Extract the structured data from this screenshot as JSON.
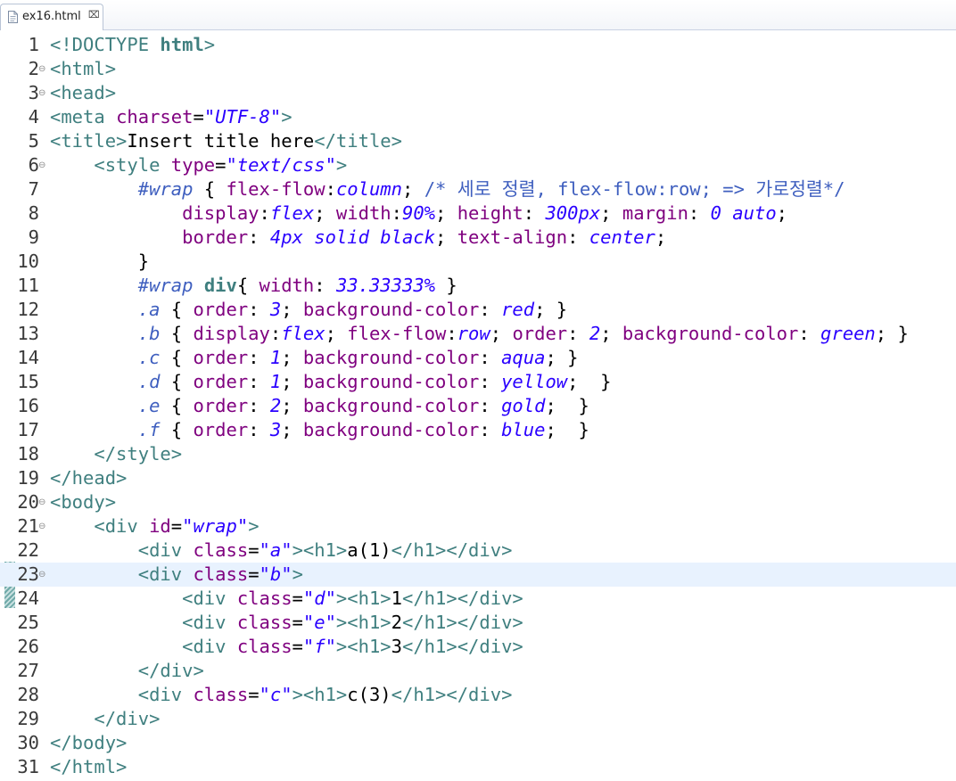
{
  "tab": {
    "title": "ex16.html",
    "close_glyph": "⌧",
    "icon": "html-file-icon"
  },
  "current_line": 23,
  "lines": [
    {
      "n": "1",
      "fold": false,
      "tokens": [
        [
          "k",
          "<!DOCTYPE "
        ],
        [
          "b",
          "html"
        ],
        [
          "k",
          ">"
        ]
      ]
    },
    {
      "n": "2",
      "fold": true,
      "tokens": [
        [
          "k",
          "<html>"
        ]
      ]
    },
    {
      "n": "3",
      "fold": true,
      "tokens": [
        [
          "k",
          "<head>"
        ]
      ]
    },
    {
      "n": "4",
      "fold": false,
      "tokens": [
        [
          "k",
          "<meta "
        ],
        [
          "a",
          "charset"
        ],
        [
          "t",
          "="
        ],
        [
          "s",
          "\"UTF-8\""
        ],
        [
          "k",
          ">"
        ]
      ]
    },
    {
      "n": "5",
      "fold": false,
      "tokens": [
        [
          "k",
          "<title>"
        ],
        [
          "t",
          "Insert title here"
        ],
        [
          "k",
          "</title>"
        ]
      ]
    },
    {
      "n": "6",
      "fold": true,
      "tokens": [
        [
          "t",
          "    "
        ],
        [
          "k",
          "<style "
        ],
        [
          "a",
          "type"
        ],
        [
          "t",
          "="
        ],
        [
          "s",
          "\"text/css\""
        ],
        [
          "k",
          ">"
        ]
      ]
    },
    {
      "n": "7",
      "fold": false,
      "tokens": [
        [
          "t",
          "        "
        ],
        [
          "sel",
          "#wrap"
        ],
        [
          "t",
          " { "
        ],
        [
          "a",
          "flex-flow"
        ],
        [
          "t",
          ":"
        ],
        [
          "s",
          "column"
        ],
        [
          "t",
          "; "
        ],
        [
          "c",
          "/* 세로 정렬, flex-flow:row; => 가로정렬*/"
        ]
      ]
    },
    {
      "n": "8",
      "fold": false,
      "tokens": [
        [
          "t",
          "            "
        ],
        [
          "a",
          "display"
        ],
        [
          "t",
          ":"
        ],
        [
          "s",
          "flex"
        ],
        [
          "t",
          "; "
        ],
        [
          "a",
          "width"
        ],
        [
          "t",
          ":"
        ],
        [
          "s",
          "90%"
        ],
        [
          "t",
          "; "
        ],
        [
          "a",
          "height"
        ],
        [
          "t",
          ": "
        ],
        [
          "s",
          "300px"
        ],
        [
          "t",
          "; "
        ],
        [
          "a",
          "margin"
        ],
        [
          "t",
          ": "
        ],
        [
          "s",
          "0 auto"
        ],
        [
          "t",
          ";"
        ]
      ]
    },
    {
      "n": "9",
      "fold": false,
      "tokens": [
        [
          "t",
          "            "
        ],
        [
          "a",
          "border"
        ],
        [
          "t",
          ": "
        ],
        [
          "s",
          "4px solid black"
        ],
        [
          "t",
          "; "
        ],
        [
          "a",
          "text-align"
        ],
        [
          "t",
          ": "
        ],
        [
          "s",
          "center"
        ],
        [
          "t",
          ";"
        ]
      ]
    },
    {
      "n": "10",
      "fold": false,
      "tokens": [
        [
          "t",
          "        }"
        ]
      ]
    },
    {
      "n": "11",
      "fold": false,
      "tokens": [
        [
          "t",
          "        "
        ],
        [
          "sel",
          "#wrap "
        ],
        [
          "b",
          "div"
        ],
        [
          "t",
          "{ "
        ],
        [
          "a",
          "width"
        ],
        [
          "t",
          ": "
        ],
        [
          "s",
          "33.33333%"
        ],
        [
          "t",
          " }"
        ]
      ]
    },
    {
      "n": "12",
      "fold": false,
      "tokens": [
        [
          "t",
          "        "
        ],
        [
          "sel",
          ".a"
        ],
        [
          "t",
          " { "
        ],
        [
          "a",
          "order"
        ],
        [
          "t",
          ": "
        ],
        [
          "s",
          "3"
        ],
        [
          "t",
          "; "
        ],
        [
          "a",
          "background-color"
        ],
        [
          "t",
          ": "
        ],
        [
          "s",
          "red"
        ],
        [
          "t",
          "; }"
        ]
      ]
    },
    {
      "n": "13",
      "fold": false,
      "tokens": [
        [
          "t",
          "        "
        ],
        [
          "sel",
          ".b"
        ],
        [
          "t",
          " { "
        ],
        [
          "a",
          "display"
        ],
        [
          "t",
          ":"
        ],
        [
          "s",
          "flex"
        ],
        [
          "t",
          "; "
        ],
        [
          "a",
          "flex-flow"
        ],
        [
          "t",
          ":"
        ],
        [
          "s",
          "row"
        ],
        [
          "t",
          "; "
        ],
        [
          "a",
          "order"
        ],
        [
          "t",
          ": "
        ],
        [
          "s",
          "2"
        ],
        [
          "t",
          "; "
        ],
        [
          "a",
          "background-color"
        ],
        [
          "t",
          ": "
        ],
        [
          "s",
          "green"
        ],
        [
          "t",
          "; }"
        ]
      ]
    },
    {
      "n": "14",
      "fold": false,
      "tokens": [
        [
          "t",
          "        "
        ],
        [
          "sel",
          ".c"
        ],
        [
          "t",
          " { "
        ],
        [
          "a",
          "order"
        ],
        [
          "t",
          ": "
        ],
        [
          "s",
          "1"
        ],
        [
          "t",
          "; "
        ],
        [
          "a",
          "background-color"
        ],
        [
          "t",
          ": "
        ],
        [
          "s",
          "aqua"
        ],
        [
          "t",
          "; }"
        ]
      ]
    },
    {
      "n": "15",
      "fold": false,
      "tokens": [
        [
          "t",
          "        "
        ],
        [
          "sel",
          ".d"
        ],
        [
          "t",
          " { "
        ],
        [
          "a",
          "order"
        ],
        [
          "t",
          ": "
        ],
        [
          "s",
          "1"
        ],
        [
          "t",
          "; "
        ],
        [
          "a",
          "background-color"
        ],
        [
          "t",
          ": "
        ],
        [
          "s",
          "yellow"
        ],
        [
          "t",
          ";  }"
        ]
      ]
    },
    {
      "n": "16",
      "fold": false,
      "tokens": [
        [
          "t",
          "        "
        ],
        [
          "sel",
          ".e"
        ],
        [
          "t",
          " { "
        ],
        [
          "a",
          "order"
        ],
        [
          "t",
          ": "
        ],
        [
          "s",
          "2"
        ],
        [
          "t",
          "; "
        ],
        [
          "a",
          "background-color"
        ],
        [
          "t",
          ": "
        ],
        [
          "s",
          "gold"
        ],
        [
          "t",
          ";  }"
        ]
      ]
    },
    {
      "n": "17",
      "fold": false,
      "tokens": [
        [
          "t",
          "        "
        ],
        [
          "sel",
          ".f"
        ],
        [
          "t",
          " { "
        ],
        [
          "a",
          "order"
        ],
        [
          "t",
          ": "
        ],
        [
          "s",
          "3"
        ],
        [
          "t",
          "; "
        ],
        [
          "a",
          "background-color"
        ],
        [
          "t",
          ": "
        ],
        [
          "s",
          "blue"
        ],
        [
          "t",
          ";  }"
        ]
      ]
    },
    {
      "n": "18",
      "fold": false,
      "tokens": [
        [
          "t",
          "    "
        ],
        [
          "k",
          "</style>"
        ]
      ]
    },
    {
      "n": "19",
      "fold": false,
      "tokens": [
        [
          "k",
          "</head>"
        ]
      ]
    },
    {
      "n": "20",
      "fold": true,
      "tokens": [
        [
          "k",
          "<body>"
        ]
      ]
    },
    {
      "n": "21",
      "fold": true,
      "tokens": [
        [
          "t",
          "    "
        ],
        [
          "k",
          "<div "
        ],
        [
          "a",
          "id"
        ],
        [
          "t",
          "="
        ],
        [
          "s",
          "\"wrap\""
        ],
        [
          "k",
          ">"
        ]
      ]
    },
    {
      "n": "22",
      "fold": false,
      "tokens": [
        [
          "t",
          "        "
        ],
        [
          "k",
          "<div "
        ],
        [
          "a",
          "class"
        ],
        [
          "t",
          "="
        ],
        [
          "s",
          "\"a\""
        ],
        [
          "k",
          "><h1>"
        ],
        [
          "t",
          "a(1)"
        ],
        [
          "k",
          "</h1></div>"
        ]
      ]
    },
    {
      "n": "23",
      "fold": true,
      "tokens": [
        [
          "t",
          "        "
        ],
        [
          "k",
          "<div "
        ],
        [
          "a",
          "class"
        ],
        [
          "t",
          "="
        ],
        [
          "s",
          "\"b\""
        ],
        [
          "k",
          ">"
        ]
      ]
    },
    {
      "n": "24",
      "fold": false,
      "tokens": [
        [
          "t",
          "            "
        ],
        [
          "k",
          "<div "
        ],
        [
          "a",
          "class"
        ],
        [
          "t",
          "="
        ],
        [
          "s",
          "\"d\""
        ],
        [
          "k",
          "><h1>"
        ],
        [
          "t",
          "1"
        ],
        [
          "k",
          "</h1></div>"
        ]
      ]
    },
    {
      "n": "25",
      "fold": false,
      "tokens": [
        [
          "t",
          "            "
        ],
        [
          "k",
          "<div "
        ],
        [
          "a",
          "class"
        ],
        [
          "t",
          "="
        ],
        [
          "s",
          "\"e\""
        ],
        [
          "k",
          "><h1>"
        ],
        [
          "t",
          "2"
        ],
        [
          "k",
          "</h1></div>"
        ]
      ]
    },
    {
      "n": "26",
      "fold": false,
      "tokens": [
        [
          "t",
          "            "
        ],
        [
          "k",
          "<div "
        ],
        [
          "a",
          "class"
        ],
        [
          "t",
          "="
        ],
        [
          "s",
          "\"f\""
        ],
        [
          "k",
          "><h1>"
        ],
        [
          "t",
          "3"
        ],
        [
          "k",
          "</h1></div>"
        ]
      ]
    },
    {
      "n": "27",
      "fold": false,
      "tokens": [
        [
          "t",
          "        "
        ],
        [
          "k",
          "</div>"
        ]
      ]
    },
    {
      "n": "28",
      "fold": false,
      "tokens": [
        [
          "t",
          "        "
        ],
        [
          "k",
          "<div "
        ],
        [
          "a",
          "class"
        ],
        [
          "t",
          "="
        ],
        [
          "s",
          "\"c\""
        ],
        [
          "k",
          "><h1>"
        ],
        [
          "t",
          "c(3)"
        ],
        [
          "k",
          "</h1></div>"
        ]
      ]
    },
    {
      "n": "29",
      "fold": false,
      "tokens": [
        [
          "t",
          "    "
        ],
        [
          "k",
          "</div>"
        ]
      ]
    },
    {
      "n": "30",
      "fold": false,
      "tokens": [
        [
          "k",
          "</body>"
        ]
      ]
    },
    {
      "n": "31",
      "fold": false,
      "tokens": [
        [
          "k",
          "</html>"
        ]
      ]
    }
  ]
}
